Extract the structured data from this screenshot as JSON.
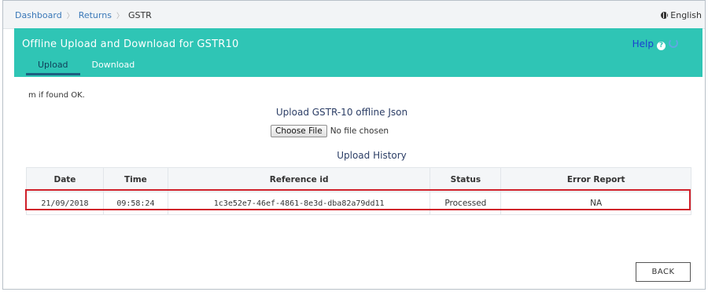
{
  "breadcrumb": {
    "items": [
      "Dashboard",
      "Returns"
    ],
    "current": "GSTR"
  },
  "language": "English",
  "header": {
    "title": "Offline Upload and Download for GSTR10",
    "help": "Help"
  },
  "tabs": [
    {
      "label": "Upload",
      "active": true
    },
    {
      "label": "Download",
      "active": false
    }
  ],
  "note": "m if found OK.",
  "upload": {
    "title": "Upload GSTR-10 offline Json",
    "choose_label": "Choose File",
    "file_status": "No file chosen"
  },
  "history": {
    "title": "Upload History",
    "columns": [
      "Date",
      "Time",
      "Reference id",
      "Status",
      "Error Report"
    ],
    "rows": [
      [
        "21/09/2018",
        "09:58:24",
        "1c3e52e7-46ef-4861-8e3d-dba82a79dd11",
        "Processed",
        "NA"
      ]
    ]
  },
  "back_label": "BACK",
  "colors": {
    "header_bg": "#2fc5b5",
    "highlight": "#d0202a",
    "link": "#3a78b8"
  }
}
